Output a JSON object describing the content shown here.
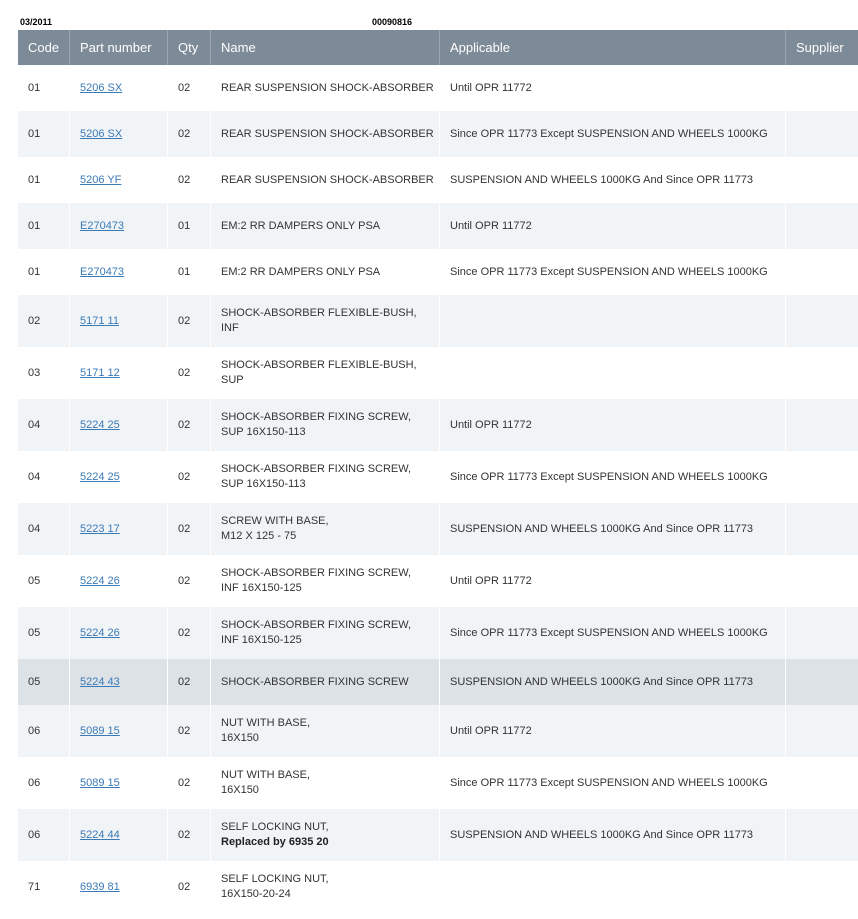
{
  "header": {
    "date": "03/2011",
    "doc_code": "00090816"
  },
  "columns": {
    "code": "Code",
    "part": "Part number",
    "qty": "Qty",
    "name": "Name",
    "applicable": "Applicable",
    "supplier": "Supplier"
  },
  "rows": [
    {
      "code": "01",
      "part": "5206 SX",
      "qty": "02",
      "name1": "REAR SUSPENSION SHOCK-ABSORBER",
      "name2": "",
      "applicable": "Until OPR 11772",
      "supplier": ""
    },
    {
      "code": "01",
      "part": "5206 SX",
      "qty": "02",
      "name1": "REAR SUSPENSION SHOCK-ABSORBER",
      "name2": "",
      "applicable": "Since OPR 11773 Except SUSPENSION AND WHEELS 1000KG",
      "supplier": ""
    },
    {
      "code": "01",
      "part": "5206 YF",
      "qty": "02",
      "name1": "REAR SUSPENSION SHOCK-ABSORBER",
      "name2": "",
      "applicable": "SUSPENSION AND WHEELS 1000KG And Since OPR 11773",
      "supplier": ""
    },
    {
      "code": "01",
      "part": "E270473",
      "qty": "01",
      "name1": "EM:2 RR DAMPERS ONLY PSA",
      "name2": "",
      "applicable": "Until OPR 11772",
      "supplier": ""
    },
    {
      "code": "01",
      "part": "E270473",
      "qty": "01",
      "name1": "EM:2 RR DAMPERS ONLY PSA",
      "name2": "",
      "applicable": "Since OPR 11773 Except SUSPENSION AND WHEELS 1000KG",
      "supplier": ""
    },
    {
      "code": "02",
      "part": "5171 11",
      "qty": "02",
      "name1": "SHOCK-ABSORBER FLEXIBLE-BUSH,",
      "name2": "INF",
      "applicable": "",
      "supplier": ""
    },
    {
      "code": "03",
      "part": "5171 12",
      "qty": "02",
      "name1": "SHOCK-ABSORBER FLEXIBLE-BUSH,",
      "name2": "SUP",
      "applicable": "",
      "supplier": ""
    },
    {
      "code": "04",
      "part": "5224 25",
      "qty": "02",
      "name1": "SHOCK-ABSORBER FIXING SCREW,",
      "name2": "SUP 16X150-113",
      "applicable": "Until OPR 11772",
      "supplier": ""
    },
    {
      "code": "04",
      "part": "5224 25",
      "qty": "02",
      "name1": "SHOCK-ABSORBER FIXING SCREW,",
      "name2": "SUP 16X150-113",
      "applicable": "Since OPR 11773 Except SUSPENSION AND WHEELS 1000KG",
      "supplier": ""
    },
    {
      "code": "04",
      "part": "5223 17",
      "qty": "02",
      "name1": "SCREW WITH BASE,",
      "name2": "M12 X 125 - 75",
      "applicable": "SUSPENSION AND WHEELS 1000KG And Since OPR 11773",
      "supplier": ""
    },
    {
      "code": "05",
      "part": "5224 26",
      "qty": "02",
      "name1": "SHOCK-ABSORBER FIXING SCREW,",
      "name2": "INF 16X150-125",
      "applicable": "Until OPR 11772",
      "supplier": ""
    },
    {
      "code": "05",
      "part": "5224 26",
      "qty": "02",
      "name1": "SHOCK-ABSORBER FIXING SCREW,",
      "name2": "INF 16X150-125",
      "applicable": "Since OPR 11773 Except SUSPENSION AND WHEELS 1000KG",
      "supplier": ""
    },
    {
      "code": "05",
      "part": "5224 43",
      "qty": "02",
      "name1": "SHOCK-ABSORBER FIXING SCREW",
      "name2": "",
      "applicable": "SUSPENSION AND WHEELS 1000KG And Since OPR 11773",
      "supplier": ""
    },
    {
      "code": "06",
      "part": "5089 15",
      "qty": "02",
      "name1": "NUT WITH BASE,",
      "name2": "16X150",
      "applicable": "Until OPR 11772",
      "supplier": ""
    },
    {
      "code": "06",
      "part": "5089 15",
      "qty": "02",
      "name1": "NUT WITH BASE,",
      "name2": "16X150",
      "applicable": "Since OPR 11773 Except SUSPENSION AND WHEELS 1000KG",
      "supplier": ""
    },
    {
      "code": "06",
      "part": "5224 44",
      "qty": "02",
      "name1": "SELF LOCKING NUT,",
      "name2": "Replaced by 6935 20",
      "applicable": "SUSPENSION AND WHEELS 1000KG And Since OPR 11773",
      "supplier": ""
    },
    {
      "code": "71",
      "part": "6939 81",
      "qty": "02",
      "name1": "SELF LOCKING NUT,",
      "name2": "16X150-20-24",
      "applicable": "",
      "supplier": ""
    }
  ],
  "highlighted_row": 12,
  "bold_name2_row": 15
}
